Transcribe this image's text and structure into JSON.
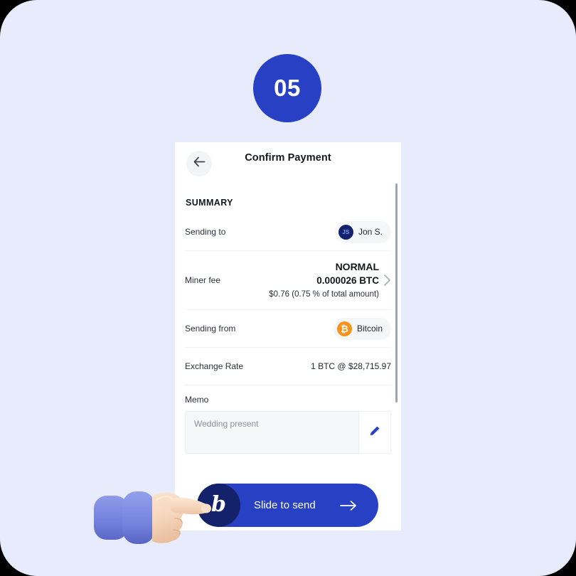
{
  "theme": {
    "background": "#e8ebfc",
    "accent_blue": "#2740c4",
    "dark_navy": "#14226b",
    "bitcoin_orange": "#f7931a",
    "card_white": "#ffffff"
  },
  "step_badge": {
    "number": "05"
  },
  "screen": {
    "title": "Confirm Payment",
    "back_icon": "arrow-left-icon",
    "section_heading": "SUMMARY",
    "rows": {
      "sending_to": {
        "label": "Sending to",
        "chip_text": "Jon S.",
        "avatar_initials": "JS"
      },
      "miner_fee": {
        "label": "Miner fee",
        "speed": "NORMAL",
        "amount_btc": "0.000026 BTC",
        "amount_fiat": "$0.76 (0.75 % of total amount)",
        "chevron_icon": "chevron-right-icon"
      },
      "sending_from": {
        "label": "Sending from",
        "chip_text": "Bitcoin",
        "coin_icon": "bitcoin-icon",
        "coin_symbol": "₿"
      },
      "exchange_rate": {
        "label": "Exchange Rate",
        "value": "1 BTC @ $28,715.97"
      },
      "memo": {
        "label": "Memo",
        "placeholder": "Wedding present",
        "value": "",
        "edit_icon": "pencil-icon"
      }
    },
    "slide_button": {
      "label": "Slide to send",
      "knob_glyph": "b",
      "arrow_icon": "arrow-right-icon"
    },
    "scrollbar": "vertical-scrollbar"
  },
  "pointer": {
    "icon": "pointing-hand-cursor"
  }
}
